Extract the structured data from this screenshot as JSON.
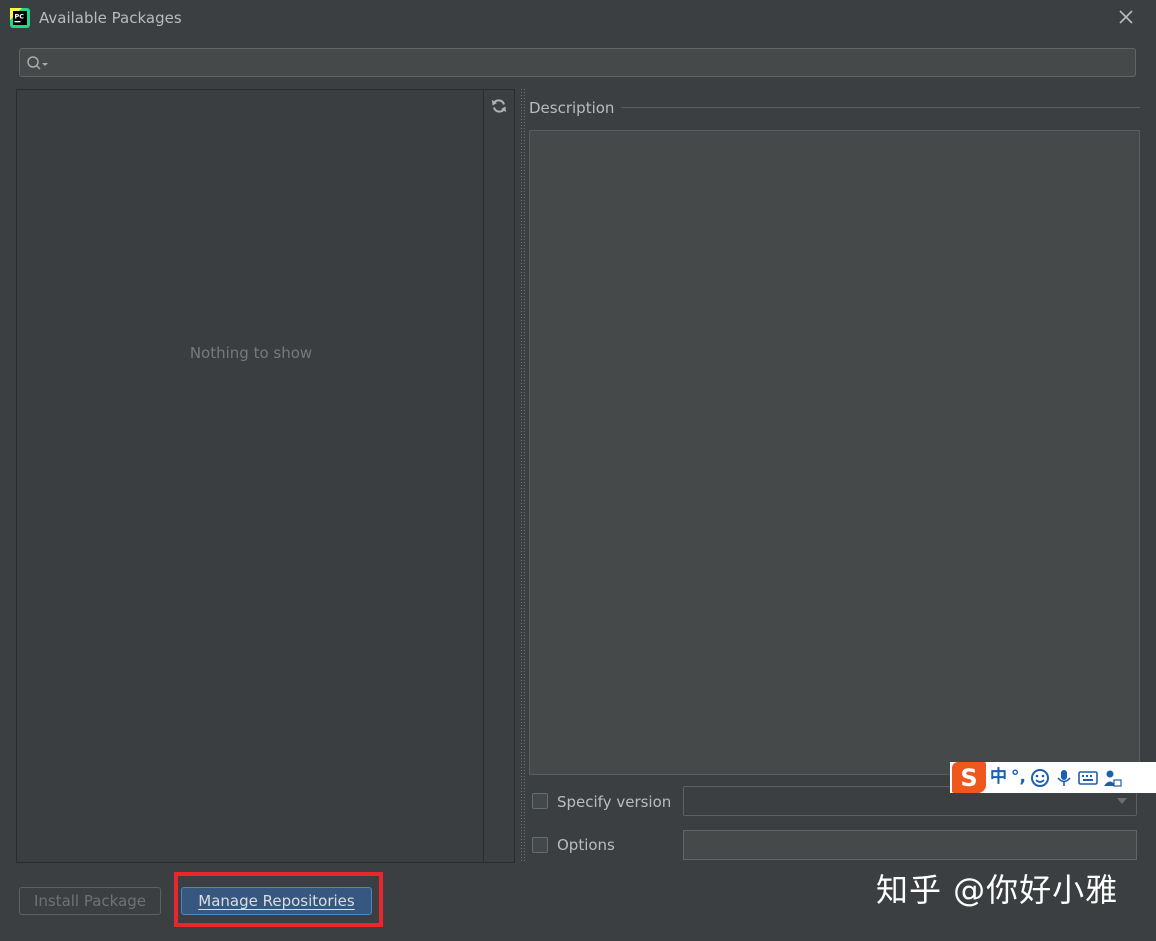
{
  "window": {
    "title": "Available Packages",
    "close_icon": "close-icon",
    "app_icon": "pycharm-icon"
  },
  "search": {
    "value": "",
    "placeholder": "",
    "icon": "search-icon"
  },
  "package_list": {
    "empty_text": "Nothing to show",
    "refresh_icon": "refresh-icon"
  },
  "description": {
    "label": "Description",
    "content": ""
  },
  "specify_version": {
    "label": "Specify version",
    "checked": false,
    "selected_value": ""
  },
  "options": {
    "label": "Options",
    "checked": false,
    "value": ""
  },
  "buttons": {
    "install_label": "Install Package",
    "manage_label": "Manage Repositories"
  },
  "ime_toolbar": {
    "logo": "S",
    "mode_text": "中",
    "punct_text": "°,"
  },
  "watermark": {
    "text": "知乎 @你好小雅"
  },
  "colors": {
    "background": "#3c3f41",
    "field": "#45494a",
    "primary_button": "#365880",
    "highlight": "#e7262e",
    "ime_logo": "#f0571c"
  }
}
